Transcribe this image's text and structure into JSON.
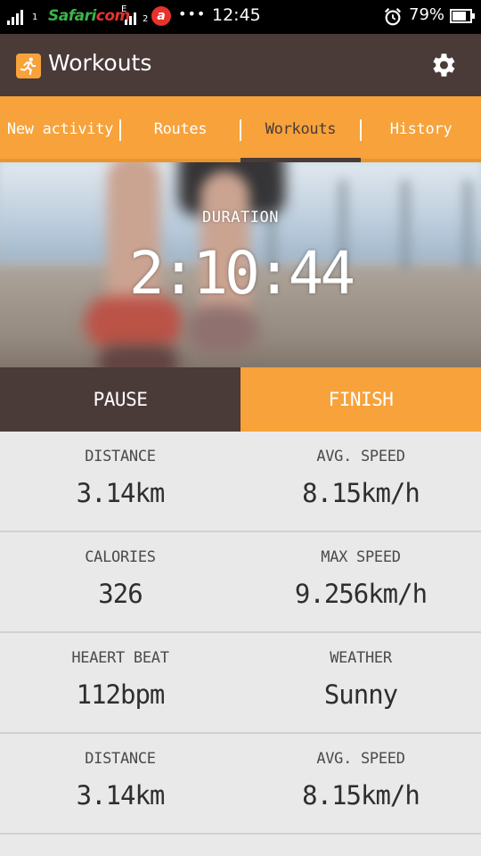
{
  "status_bar": {
    "carrier_prefix": "Safari",
    "carrier_suffix": "com",
    "network_letter": "E",
    "sim1": "1",
    "sim2": "2",
    "operator_badge": "a",
    "dots": "•••",
    "time": "12:45",
    "battery_percent": "79%",
    "battery_level": 0.79,
    "icons": [
      "signal-icon",
      "signal-icon",
      "alarm-icon",
      "battery-icon"
    ]
  },
  "app_bar": {
    "title": "Workouts",
    "app_icon": "runner-icon",
    "settings_icon": "gear-icon"
  },
  "tabs": [
    {
      "label": "New activity",
      "active": false
    },
    {
      "label": "Routes",
      "active": false
    },
    {
      "label": "Workouts",
      "active": true
    },
    {
      "label": "History",
      "active": false
    }
  ],
  "hero": {
    "duration_label": "DURATION",
    "duration_value": "2:10:44"
  },
  "actions": {
    "pause_label": "PAUSE",
    "finish_label": "FINISH"
  },
  "stats": [
    [
      {
        "label": "DISTANCE",
        "value": "3.14km"
      },
      {
        "label": "AVG. SPEED",
        "value": "8.15km/h"
      }
    ],
    [
      {
        "label": "CALORIES",
        "value": "326"
      },
      {
        "label": "MAX SPEED",
        "value": "9.256km/h"
      }
    ],
    [
      {
        "label": "HEAERT BEAT",
        "value": "112bpm"
      },
      {
        "label": "WEATHER",
        "value": "Sunny"
      }
    ],
    [
      {
        "label": "DISTANCE",
        "value": "3.14km"
      },
      {
        "label": "AVG. SPEED",
        "value": "8.15km/h"
      }
    ]
  ],
  "colors": {
    "brown": "#4a3a38",
    "orange": "#f7a23a",
    "background": "#e9e9e9"
  }
}
